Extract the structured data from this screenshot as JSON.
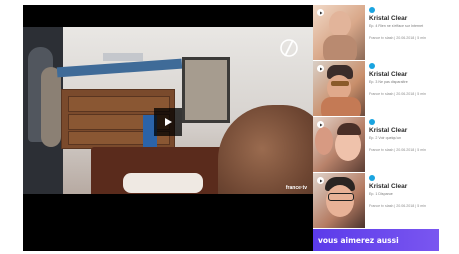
{
  "player": {
    "watermark": "france·tv"
  },
  "playlist": {
    "items": [
      {
        "title": "Kristal Clear",
        "episode": "Ep. 4 Rien ne s'efface sur Internet",
        "meta": "France tv slash | 20.06.2018 | 5 min"
      },
      {
        "title": "Kristal Clear",
        "episode": "Ep. 3 Ne pas disparaître",
        "meta": "France tv slash | 20.06.2018 | 5 min"
      },
      {
        "title": "Kristal Clear",
        "episode": "Ep. 2 Voir quelqu'un",
        "meta": "France tv slash | 20.06.2018 | 5 min"
      },
      {
        "title": "Kristal Clear",
        "episode": "Ep. 1 Disparue",
        "meta": "France tv slash | 20.06.2018 | 5 min"
      }
    ],
    "banner": "vous aimerez aussi"
  },
  "colors": {
    "brand_blue": "#1aa4e0",
    "banner_purple": "#5b3bea"
  },
  "icons": {
    "play": "play-icon",
    "logo": "slash-logo-icon"
  }
}
